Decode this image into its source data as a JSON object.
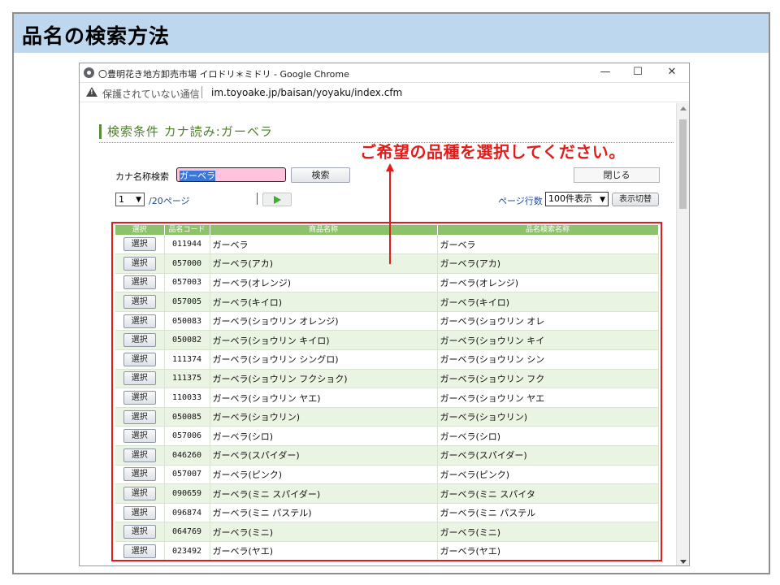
{
  "slide": {
    "title": "品名の検索方法"
  },
  "window": {
    "title": "〇豊明花き地方卸売市場 イロドリ＊ミドリ - Google Chrome",
    "minimize": "—",
    "maximize": "☐",
    "close": "✕"
  },
  "address": {
    "security_label": "保護されていない通信",
    "url": "im.toyoake.jp/baisan/yoyaku/index.cfm"
  },
  "page": {
    "heading": "検索条件 カナ読み:ガーベラ",
    "annotation": "ご希望の品種を選択してください。",
    "search": {
      "label": "カナ名称検索",
      "value": "ガーベラ",
      "button": "検索"
    },
    "close_button": "閉じる",
    "pager": {
      "current": "1",
      "total": "/20ページ"
    },
    "rows_label": "ページ行数",
    "rows_value": "100件表示",
    "switch_button": "表示切替"
  },
  "table": {
    "headers": [
      "選択",
      "品名コード",
      "商品名称",
      "品名検索名称"
    ],
    "select_label": "選択",
    "rows": [
      {
        "code": "011944",
        "name": "ガーベラ",
        "search": "ガーベラ"
      },
      {
        "code": "057000",
        "name": "ガーベラ(アカ)",
        "search": "ガーベラ(アカ)"
      },
      {
        "code": "057003",
        "name": "ガーベラ(オレンジ)",
        "search": "ガーベラ(オレンジ)"
      },
      {
        "code": "057005",
        "name": "ガーベラ(キイロ)",
        "search": "ガーベラ(キイロ)"
      },
      {
        "code": "050083",
        "name": "ガーベラ(ショウリン オレンジ)",
        "search": "ガーベラ(ショウリン オレ"
      },
      {
        "code": "050082",
        "name": "ガーベラ(ショウリン キイロ)",
        "search": "ガーベラ(ショウリン キイ"
      },
      {
        "code": "111374",
        "name": "ガーベラ(ショウリン シングロ)",
        "search": "ガーベラ(ショウリン シン"
      },
      {
        "code": "111375",
        "name": "ガーベラ(ショウリン フクショク)",
        "search": "ガーベラ(ショウリン フク"
      },
      {
        "code": "110033",
        "name": "ガーベラ(ショウリン ヤエ)",
        "search": "ガーベラ(ショウリン ヤエ"
      },
      {
        "code": "050085",
        "name": "ガーベラ(ショウリン)",
        "search": "ガーベラ(ショウリン)"
      },
      {
        "code": "057006",
        "name": "ガーベラ(シロ)",
        "search": "ガーベラ(シロ)"
      },
      {
        "code": "046260",
        "name": "ガーベラ(スパイダー)",
        "search": "ガーベラ(スパイダー)"
      },
      {
        "code": "057007",
        "name": "ガーベラ(ピンク)",
        "search": "ガーベラ(ピンク)"
      },
      {
        "code": "090659",
        "name": "ガーベラ(ミニ スパイダー)",
        "search": "ガーベラ(ミニ スパイタ"
      },
      {
        "code": "096874",
        "name": "ガーベラ(ミニ パステル)",
        "search": "ガーベラ(ミニ パステル"
      },
      {
        "code": "064769",
        "name": "ガーベラ(ミニ)",
        "search": "ガーベラ(ミニ)"
      },
      {
        "code": "023492",
        "name": "ガーベラ(ヤエ)",
        "search": "ガーベラ(ヤエ)"
      }
    ]
  },
  "colors": {
    "header_band": "#bdd7ee",
    "annotation": "#e31b1b",
    "table_header": "#8cc26a",
    "row_alt": "#eaf4e2",
    "search_input": "#ffc3de"
  },
  "icons": [
    "chrome-icon",
    "warning-icon",
    "play-icon",
    "chevron-down-icon"
  ]
}
